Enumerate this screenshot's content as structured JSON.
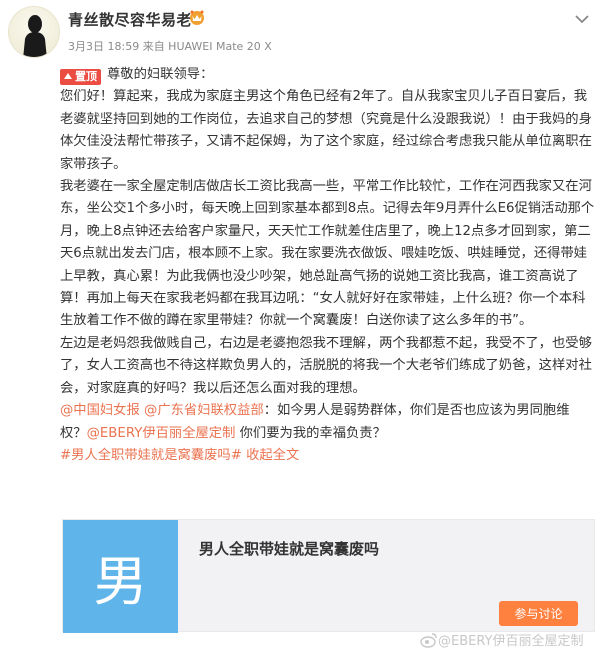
{
  "post": {
    "author": "青丝散尽容华易老",
    "meta": "3月3日  18:59 来自 HUAWEI Mate 20 X",
    "pin_badge": "置顶",
    "greeting": "尊敬的妇联领导：",
    "para1": "您们好！算起来，我成为家庭主男这个角色已经有2年了。自从我家宝贝儿子百日宴后，我老婆就坚持回到她的工作岗位，去追求自己的梦想（究竟是什么没跟我说）！由于我妈的身体欠佳没法帮忙带孩子，又请不起保姆，为了这个家庭，经过综合考虑我只能从单位离职在家带孩子。",
    "para2": "我老婆在一家全屋定制店做店长工资比我高一些，平常工作比较忙，工作在河西我家又在河东，坐公交1个多小时，每天晚上回到家基本都到8点。记得去年9月弄什么E6促销活动那个月，晚上8点钟还去给客户家量尺，天天忙工作就差住店里了，晚上12点多才回到家，第二天6点就出发去门店，根本顾不上家。我在家要洗衣做饭、喂娃吃饭、哄娃睡觉，还得带娃上早教，真心累！为此我俩也没少吵架，她总趾高气扬的说她工资比我高，谁工资高说了算！再加上每天在家我老妈都在我耳边吼：“女人就好好在家带娃，上什么班？你一个本科生放着工作不做的蹲在家里带娃？你就一个窝囊废！白送你读了这么多年的书”。",
    "para3": "左边是老妈怨我做贱自己，右边是老婆抱怨我不理解，两个我都惹不起，我受不了，也受够了，女人工资高也不待这样欺负男人的，活脱脱的将我一个大老爷们练成了奶爸，这样对社会，对家庭真的好吗？我以后还怎么面对我的理想。",
    "mention1": "@中国妇女报",
    "mention2": "@广东省妇联权益部",
    "text4a": "：如今男人是弱势群体，你们是否也应该为男同胞维权？",
    "mention3": "@EBERY伊百丽全屋定制",
    "text4b": " 你们要为我的幸福负责？",
    "topic": "#男人全职带娃就是窝囊废吗#",
    "expand": "收起全文"
  },
  "card": {
    "thumb_char": "男",
    "title": "男人全职带娃就是窝囊废吗",
    "button": "参与讨论"
  },
  "watermark": "@EBERY伊百丽全屋定制",
  "colors": {
    "link": "#eb7350",
    "badge": "#eb4d42",
    "card_thumb": "#5fb4ea",
    "card_button": "#ff8140"
  },
  "icons": {
    "vip": "vip-crown-icon",
    "chevron": "chevron-down-icon",
    "weibo": "weibo-logo-icon"
  }
}
